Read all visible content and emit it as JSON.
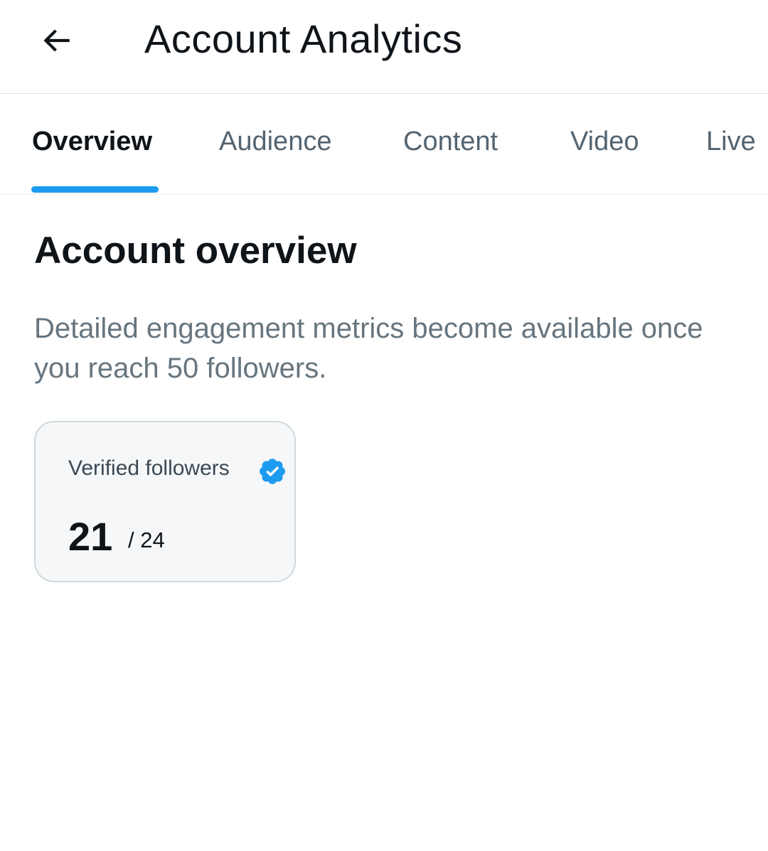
{
  "header": {
    "back_icon": "arrow-left-icon",
    "title": "Account Analytics"
  },
  "tabs": [
    {
      "label": "Overview",
      "active": true
    },
    {
      "label": "Audience",
      "active": false
    },
    {
      "label": "Content",
      "active": false
    },
    {
      "label": "Video",
      "active": false
    },
    {
      "label": "Live",
      "active": false
    }
  ],
  "overview": {
    "title": "Account overview",
    "description": "Detailed engagement metrics become available once you reach 50 followers."
  },
  "stat_card": {
    "label": "Verified followers",
    "icon": "verified-badge-icon",
    "value": "21",
    "total": "/ 24"
  },
  "colors": {
    "accent": "#1d9bf0",
    "text_primary": "#0f1419",
    "text_secondary": "#536471",
    "card_background": "#f5f7f8",
    "card_border": "#cfd9de"
  }
}
